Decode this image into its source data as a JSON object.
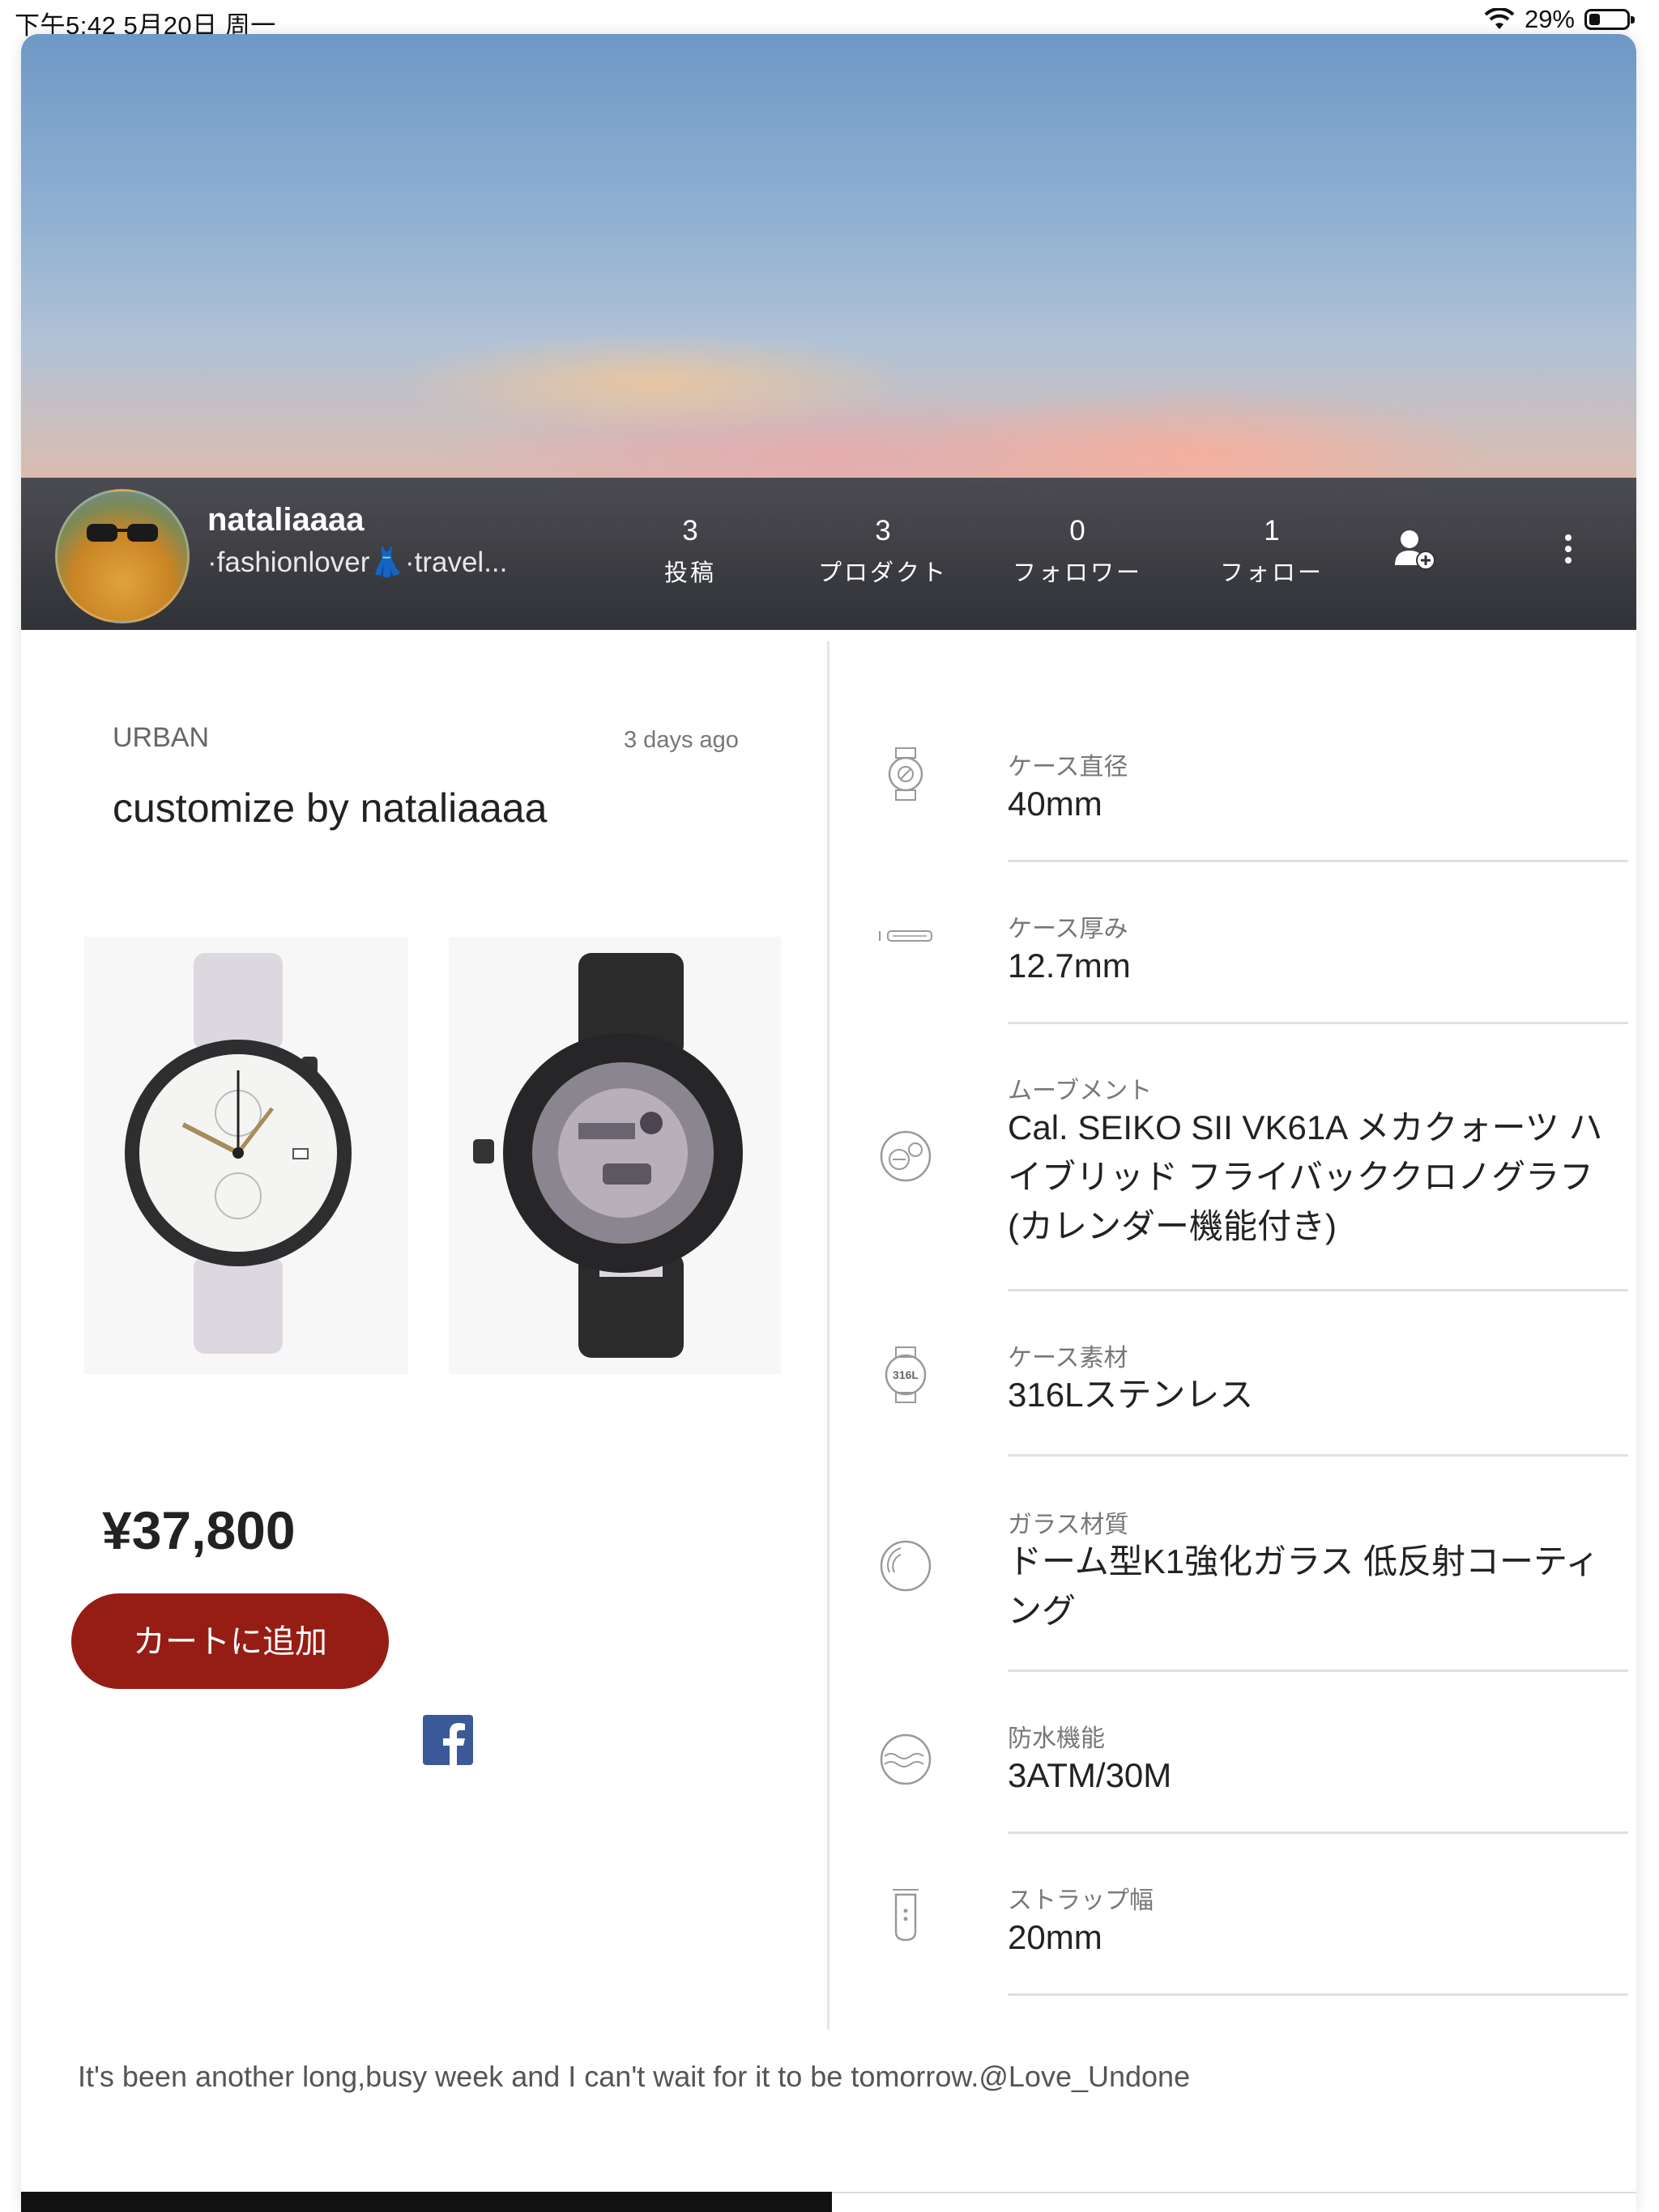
{
  "status_bar": {
    "time_date": "下午5:42   5月20日 周一",
    "battery": "29%",
    "battery_level": 0.29
  },
  "profile": {
    "username": "nataliaaaa",
    "bio": "·fashionlover👗·travel...",
    "stats": [
      {
        "count": "3",
        "label": "投稿"
      },
      {
        "count": "3",
        "label": "プロダクト"
      },
      {
        "count": "0",
        "label": "フォロワー"
      },
      {
        "count": "1",
        "label": "フォロー"
      }
    ]
  },
  "product": {
    "brand": "URBAN",
    "posted": "3 days ago",
    "title": "customize by nataliaaaa",
    "price": "¥37,800",
    "cart_button": "カートに追加"
  },
  "specs": [
    {
      "label": "ケース直径",
      "value": "40mm",
      "icon": "case-diameter-icon"
    },
    {
      "label": "ケース厚み",
      "value": "12.7mm",
      "icon": "case-thickness-icon"
    },
    {
      "label": "ムーブメント",
      "value": "Cal. SEIKO SII VK61A メカクォーツ ハイブリッド フライバッククロノグラフ (カレンダー機能付き)",
      "icon": "movement-icon"
    },
    {
      "label": "ケース素材",
      "value": "316Lステンレス",
      "icon": "case-material-icon"
    },
    {
      "label": "ガラス材質",
      "value": "ドーム型K1強化ガラス 低反射コーティング",
      "icon": "glass-icon"
    },
    {
      "label": "防水機能",
      "value": "3ATM/30M",
      "icon": "water-resistance-icon"
    },
    {
      "label": "ストラップ幅",
      "value": "20mm",
      "icon": "strap-width-icon"
    }
  ],
  "description": "It's been another long,busy week and I can't wait for it to be tomorrow.@Love_Undone",
  "colors": {
    "cart_button": "#961d14",
    "facebook": "#3b5998"
  }
}
